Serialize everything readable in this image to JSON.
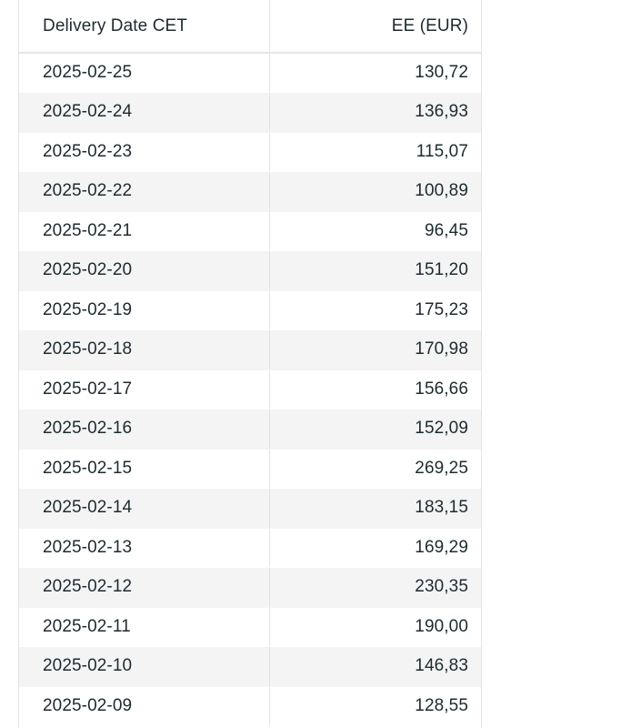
{
  "table": {
    "name": "electricity-day-ahead-prices",
    "columns": [
      {
        "key": "date",
        "label": "Delivery Date CET",
        "align": "left"
      },
      {
        "key": "value",
        "label": "EE (EUR)",
        "align": "right"
      }
    ],
    "rows": [
      {
        "date": "2025-02-25",
        "value": "130,72"
      },
      {
        "date": "2025-02-24",
        "value": "136,93"
      },
      {
        "date": "2025-02-23",
        "value": "115,07"
      },
      {
        "date": "2025-02-22",
        "value": "100,89"
      },
      {
        "date": "2025-02-21",
        "value": "96,45"
      },
      {
        "date": "2025-02-20",
        "value": "151,20"
      },
      {
        "date": "2025-02-19",
        "value": "175,23"
      },
      {
        "date": "2025-02-18",
        "value": "170,98"
      },
      {
        "date": "2025-02-17",
        "value": "156,66"
      },
      {
        "date": "2025-02-16",
        "value": "152,09"
      },
      {
        "date": "2025-02-15",
        "value": "269,25"
      },
      {
        "date": "2025-02-14",
        "value": "183,15"
      },
      {
        "date": "2025-02-13",
        "value": "169,29"
      },
      {
        "date": "2025-02-12",
        "value": "230,35"
      },
      {
        "date": "2025-02-11",
        "value": "190,00"
      },
      {
        "date": "2025-02-10",
        "value": "146,83"
      },
      {
        "date": "2025-02-09",
        "value": "128,55"
      }
    ]
  },
  "colors": {
    "text": "#1d2b30",
    "row_stripe": "#f4f4f5",
    "row_base": "#ffffff",
    "border": "#e3e3e5",
    "header_rule": "#e6e6e8"
  }
}
